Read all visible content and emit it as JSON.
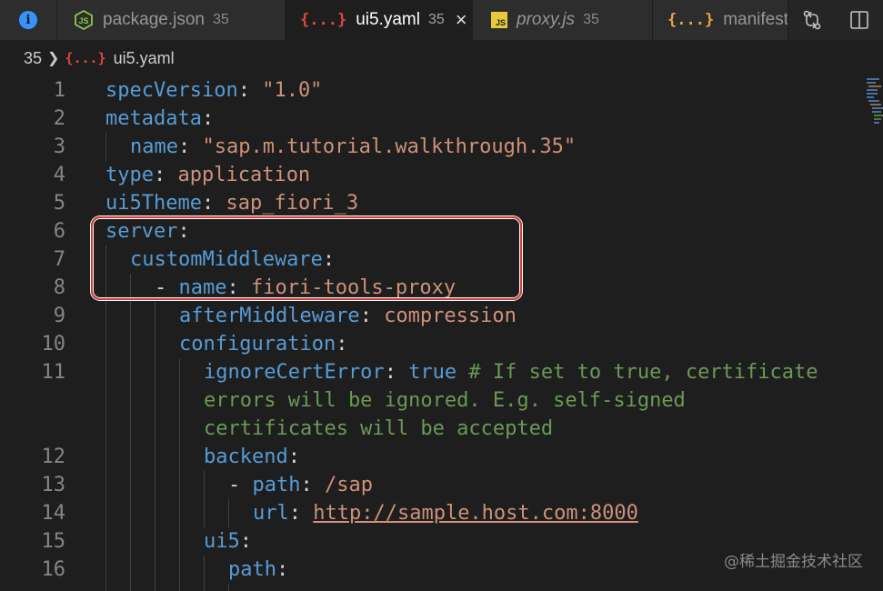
{
  "tabs": [
    {
      "name": "package.json",
      "badge": "35"
    },
    {
      "name": "ui5.yaml",
      "badge": "35",
      "close": "×"
    },
    {
      "name": "proxy.js",
      "badge": "35"
    },
    {
      "name": "manifest.js"
    }
  ],
  "icons": {
    "info": "i",
    "braces": "{...}",
    "js": "JS"
  },
  "breadcrumb": {
    "folder": "35",
    "file": "ui5.yaml"
  },
  "line_numbers": [
    "1",
    "2",
    "3",
    "4",
    "5",
    "6",
    "7",
    "8",
    "9",
    "10",
    "11",
    "12",
    "13",
    "14",
    "15",
    "16"
  ],
  "code": {
    "l1": {
      "key": "specVersion",
      "colon": ": ",
      "value": "\"1.0\""
    },
    "l2": {
      "key": "metadata",
      "colon": ":"
    },
    "l3": {
      "key": "name",
      "colon": ": ",
      "value": "\"sap.m.tutorial.walkthrough.35\""
    },
    "l4": {
      "key": "type",
      "colon": ": ",
      "value": "application"
    },
    "l5": {
      "key": "ui5Theme",
      "colon": ": ",
      "value": "sap_fiori_3"
    },
    "l6": {
      "key": "server",
      "colon": ":"
    },
    "l7": {
      "key": "customMiddleware",
      "colon": ":"
    },
    "l8": {
      "dash": "- ",
      "key": "name",
      "colon": ": ",
      "value": "fiori-tools-proxy"
    },
    "l9": {
      "key": "afterMiddleware",
      "colon": ": ",
      "value": "compression"
    },
    "l10": {
      "key": "configuration",
      "colon": ":"
    },
    "l11": {
      "key": "ignoreCertError",
      "colon": ": ",
      "value": "true",
      "comment1": " # If set to true, certificate",
      "comment2": "errors will be ignored. E.g. self-signed",
      "comment3": "certificates will be accepted"
    },
    "l12": {
      "key": "backend",
      "colon": ":"
    },
    "l13": {
      "dash": "- ",
      "key": "path",
      "colon": ": ",
      "value": "/sap"
    },
    "l14": {
      "key": "url",
      "colon": ": ",
      "value": "http://sample.host.com:8000"
    },
    "l15": {
      "key": "ui5",
      "colon": ":"
    },
    "l16": {
      "key": "path",
      "colon": ":"
    }
  },
  "colors": {
    "key": "#569cd6",
    "string": "#ce9178",
    "comment": "#6a9955",
    "highlight_border": "#d33a3a"
  },
  "watermark": "@稀土掘金技术社区"
}
